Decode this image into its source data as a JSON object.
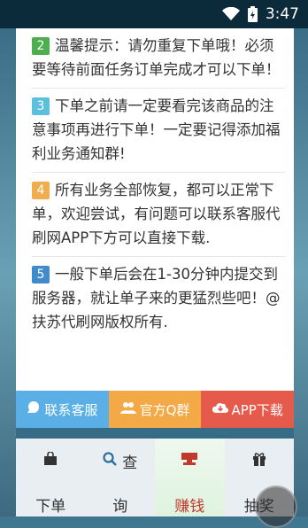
{
  "status_bar": {
    "time": "3:47"
  },
  "notices": [
    {
      "number": "2",
      "color": "#4cae4c",
      "text": "温馨提示：请勿重复下单哦！必须要等待前面任务订单完成才可以下单！"
    },
    {
      "number": "3",
      "color": "#5bc0de",
      "text": "下单之前请一定要看完该商品的注意事项再进行下单！一定要记得添加福利业务通知群!"
    },
    {
      "number": "4",
      "color": "#f0ad4e",
      "text": "所有业务全部恢复，都可以正常下单，欢迎尝试，有问题可以联系客服代刷网APP下方可以直接下载."
    },
    {
      "number": "5",
      "color": "#428bca",
      "text": "一般下单后会在1-30分钟内提交到服务器，就让单子来的更猛烈些吧！@扶苏代刷网版权所有."
    }
  ],
  "actions": [
    {
      "label": "联系客服",
      "icon": "chat-icon",
      "color": "#5ab0e6"
    },
    {
      "label": "官方Q群",
      "icon": "group-icon",
      "color": "#f3a945"
    },
    {
      "label": "APP下载",
      "icon": "cloud-download-icon",
      "color": "#e65a4c"
    }
  ],
  "tabs": [
    {
      "label": "下单",
      "icon": "shopping-bag-icon",
      "icon_text": "",
      "active": false
    },
    {
      "label": "询",
      "icon": "search-icon",
      "icon_text": "查",
      "active": false
    },
    {
      "label": "赚钱",
      "icon": "money-icon",
      "icon_text": "",
      "active": true
    },
    {
      "label": "抽奖",
      "icon": "gift-icon",
      "icon_text": "",
      "active": false
    }
  ]
}
